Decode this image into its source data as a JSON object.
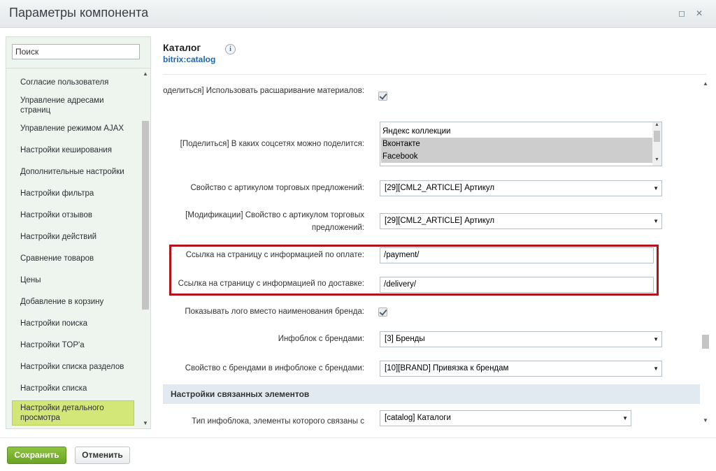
{
  "window": {
    "title": "Параметры компонента",
    "controls": [
      {
        "name": "maximize",
        "glyph": "◻"
      },
      {
        "name": "close",
        "glyph": "✕"
      }
    ]
  },
  "sidebar": {
    "search_placeholder": "Поиск",
    "items": [
      {
        "label": "Согласие пользователя"
      },
      {
        "label": "Управление адресами страниц"
      },
      {
        "label": "Управление режимом AJAX"
      },
      {
        "label": "Настройки кеширования"
      },
      {
        "label": "Дополнительные настройки"
      },
      {
        "label": "Настройки фильтра"
      },
      {
        "label": "Настройки отзывов"
      },
      {
        "label": "Настройки действий"
      },
      {
        "label": "Сравнение товаров"
      },
      {
        "label": "Цены"
      },
      {
        "label": "Добавление в корзину"
      },
      {
        "label": "Настройки поиска"
      },
      {
        "label": "Настройки TOP'а"
      },
      {
        "label": "Настройки списка разделов"
      },
      {
        "label": "Настройки списка"
      },
      {
        "label": "Настройки детального просмотра",
        "active": true
      }
    ]
  },
  "header": {
    "title": "Каталог",
    "code": "bitrix:catalog",
    "info_glyph": "i"
  },
  "settings": {
    "share_use": {
      "label": "[Поделиться] Использовать расшаривание материалов:",
      "checked": true
    },
    "share_networks": {
      "label": "[Поделиться] В каких соцсетях можно поделится:",
      "options": [
        {
          "label": "Яндекс коллекции",
          "selected": false
        },
        {
          "label": "Вконтакте",
          "selected": true
        },
        {
          "label": "Facebook",
          "selected": true
        }
      ]
    },
    "offers_article": {
      "label": "Свойство с артикулом торговых предложений:",
      "value": "[29][CML2_ARTICLE] Артикул"
    },
    "mods_article": {
      "label": "[Модификации] Свойство с артикулом торговых предложений:",
      "value": "[29][CML2_ARTICLE] Артикул"
    },
    "payment_link": {
      "label": "Ссылка на страницу с информацией по оплате:",
      "value": "/payment/"
    },
    "delivery_link": {
      "label": "Ссылка на страницу с информацией по доставке:",
      "value": "/delivery/"
    },
    "show_logo": {
      "label": "Показывать лого вместо наименования бренда:",
      "checked": true
    },
    "brand_iblock": {
      "label": "Инфоблок с брендами:",
      "value": "[3] Бренды"
    },
    "brand_prop": {
      "label": "Свойство с брендами в инфоблоке с брендами:",
      "value": "[10][BRAND] Привязка к брендам"
    },
    "related_section": {
      "title": "Настройки связанных элементов"
    },
    "related_type": {
      "label": "Тип инфоблока, элементы которого связаны с",
      "value": "[catalog] Каталоги"
    }
  },
  "footer": {
    "save_label": "Сохранить",
    "cancel_label": "Отменить"
  },
  "colors": {
    "accent_green": "#6aa324",
    "highlight_red": "#b3121a",
    "active_item": "#d3e678",
    "link_blue": "#2067b0"
  }
}
